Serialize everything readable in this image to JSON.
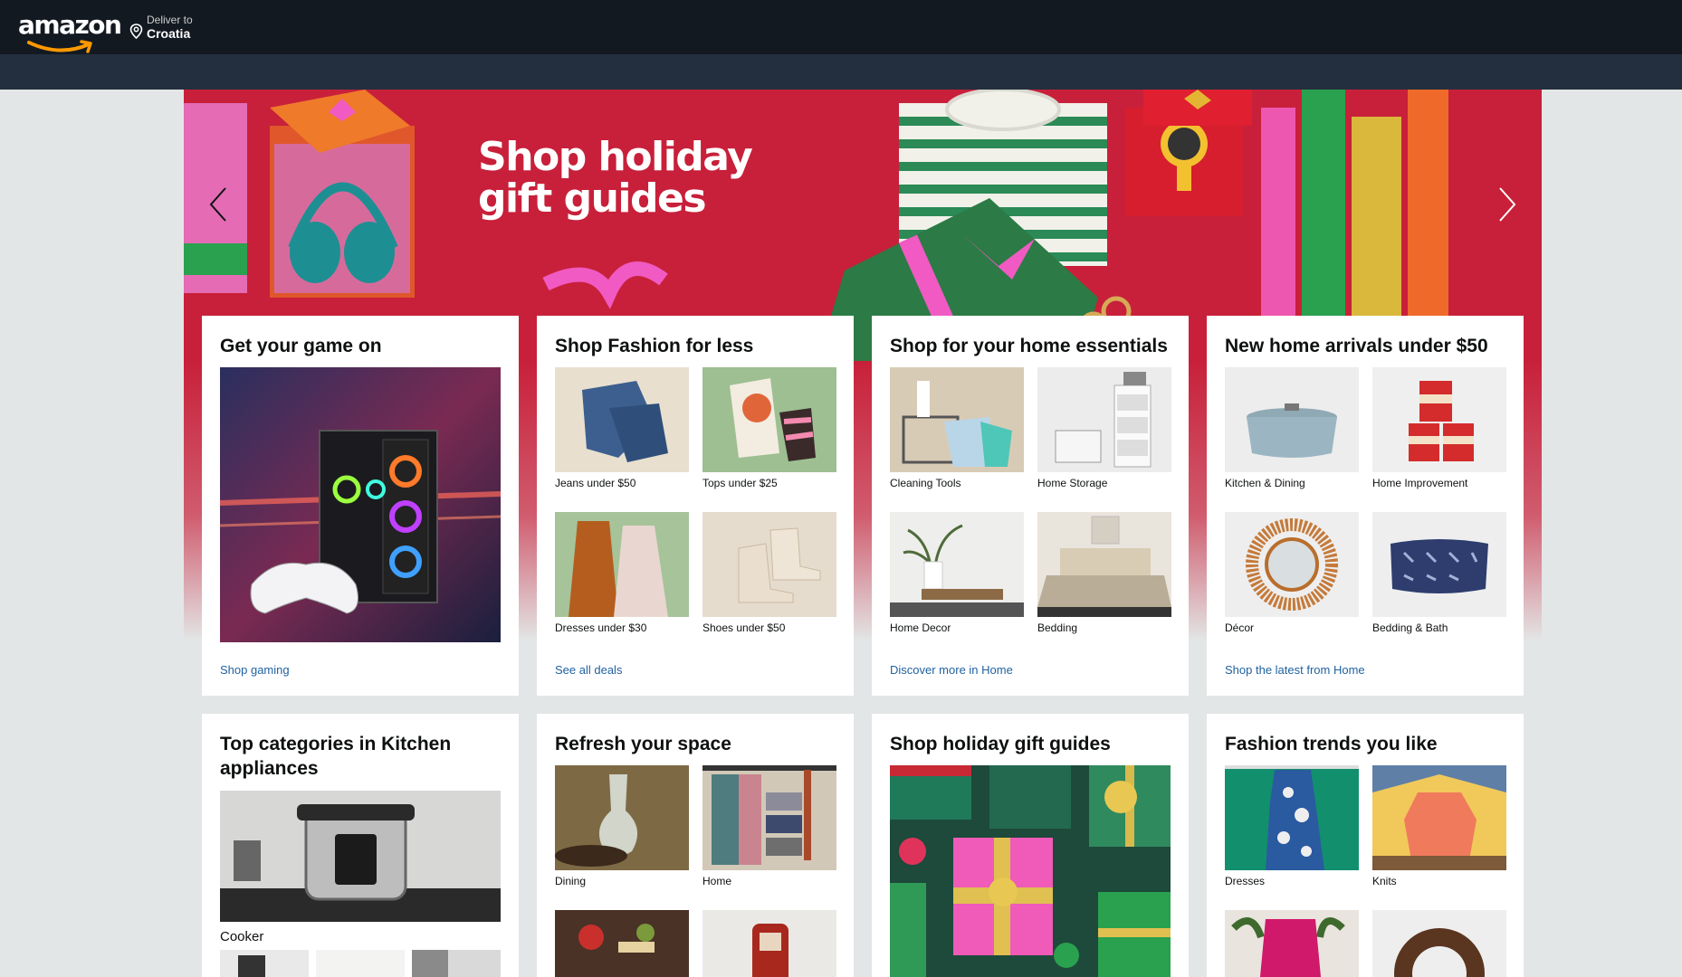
{
  "header": {
    "logo_text": "amazon",
    "deliver_label": "Deliver to",
    "deliver_location": "Croatia"
  },
  "hero": {
    "title_line1": "Shop holiday",
    "title_line2": "gift guides"
  },
  "cards": [
    {
      "title": "Get your game on",
      "link": "Shop gaming"
    },
    {
      "title": "Shop Fashion for less",
      "link": "See all deals",
      "tiles": [
        "Jeans under $50",
        "Tops under $25",
        "Dresses under $30",
        "Shoes under $50"
      ]
    },
    {
      "title": "Shop for your home essentials",
      "link": "Discover more in Home",
      "tiles": [
        "Cleaning Tools",
        "Home Storage",
        "Home Decor",
        "Bedding"
      ]
    },
    {
      "title": "New home arrivals under $50",
      "link": "Shop the latest from Home",
      "tiles": [
        "Kitchen & Dining",
        "Home Improvement",
        "Décor",
        "Bedding & Bath"
      ]
    },
    {
      "title": "Top categories in Kitchen appliances",
      "caption": "Cooker"
    },
    {
      "title": "Refresh your space",
      "tiles": [
        "Dining",
        "Home"
      ]
    },
    {
      "title": "Shop holiday gift guides"
    },
    {
      "title": "Fashion trends you like",
      "tiles": [
        "Dresses",
        "Knits"
      ]
    }
  ]
}
